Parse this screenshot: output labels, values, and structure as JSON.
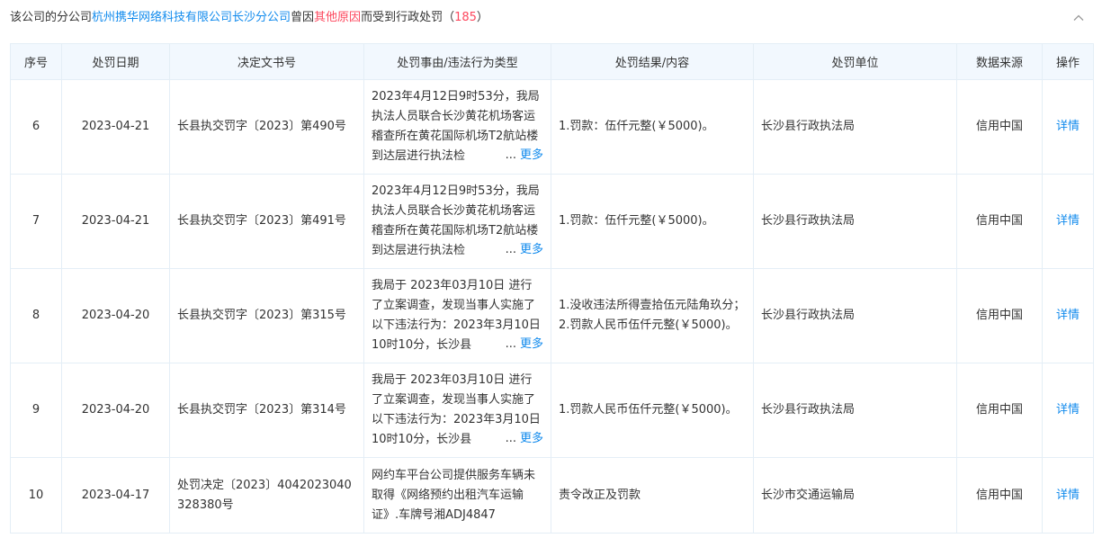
{
  "header": {
    "prefix": "该公司的分公司",
    "company": "杭州携华网络科技有限公司长沙分公司",
    "middle": "曾因",
    "reason": "其他原因",
    "suffix": "而受到行政处罚（",
    "count": "185",
    "close": "）"
  },
  "columns": [
    "序号",
    "处罚日期",
    "决定文书号",
    "处罚事由/违法行为类型",
    "处罚结果/内容",
    "处罚单位",
    "数据来源",
    "操作"
  ],
  "rows": [
    {
      "no": "6",
      "date": "2023-04-21",
      "doc": "长县执交罚字〔2023〕第490号",
      "reason": "2023年4月12日9时53分，我局执法人员联合长沙黄花机场客运稽查所在黄花国际机场T2航站楼到达层进行执法检",
      "result": "1.罚款：伍仟元整(￥5000)。",
      "unit": "长沙县行政执法局",
      "source": "信用中国",
      "action": "详情",
      "more": "更多",
      "dots": "..."
    },
    {
      "no": "7",
      "date": "2023-04-21",
      "doc": "长县执交罚字〔2023〕第491号",
      "reason": "2023年4月12日9时53分，我局执法人员联合长沙黄花机场客运稽查所在黄花国际机场T2航站楼到达层进行执法检",
      "result": "1.罚款：伍仟元整(￥5000)。",
      "unit": "长沙县行政执法局",
      "source": "信用中国",
      "action": "详情",
      "more": "更多",
      "dots": "..."
    },
    {
      "no": "8",
      "date": "2023-04-20",
      "doc": "长县执交罚字〔2023〕第315号",
      "reason": "我局于 2023年03月10日 进行了立案调查，发现当事人实施了以下违法行为：2023年3月10日10时10分，长沙县",
      "result": "1.没收违法所得壹拾伍元陆角玖分； 2.罚款人民币伍仟元整(￥5000)。",
      "unit": "长沙县行政执法局",
      "source": "信用中国",
      "action": "详情",
      "more": "更多",
      "dots": "..."
    },
    {
      "no": "9",
      "date": "2023-04-20",
      "doc": "长县执交罚字〔2023〕第314号",
      "reason": "我局于 2023年03月10日 进行了立案调查，发现当事人实施了以下违法行为：2023年3月10日10时10分，长沙县",
      "result": "1.罚款人民币伍仟元整(￥5000)。",
      "unit": "长沙县行政执法局",
      "source": "信用中国",
      "action": "详情",
      "more": "更多",
      "dots": "..."
    },
    {
      "no": "10",
      "date": "2023-04-17",
      "doc": "处罚决定〔2023〕4042023040328380号",
      "reason": "网约车平台公司提供服务车辆未取得《网络预约出租汽车运输证》.车牌号湘ADJ4847",
      "result": "责令改正及罚款",
      "unit": "长沙市交通运输局",
      "source": "信用中国",
      "action": "详情"
    }
  ]
}
